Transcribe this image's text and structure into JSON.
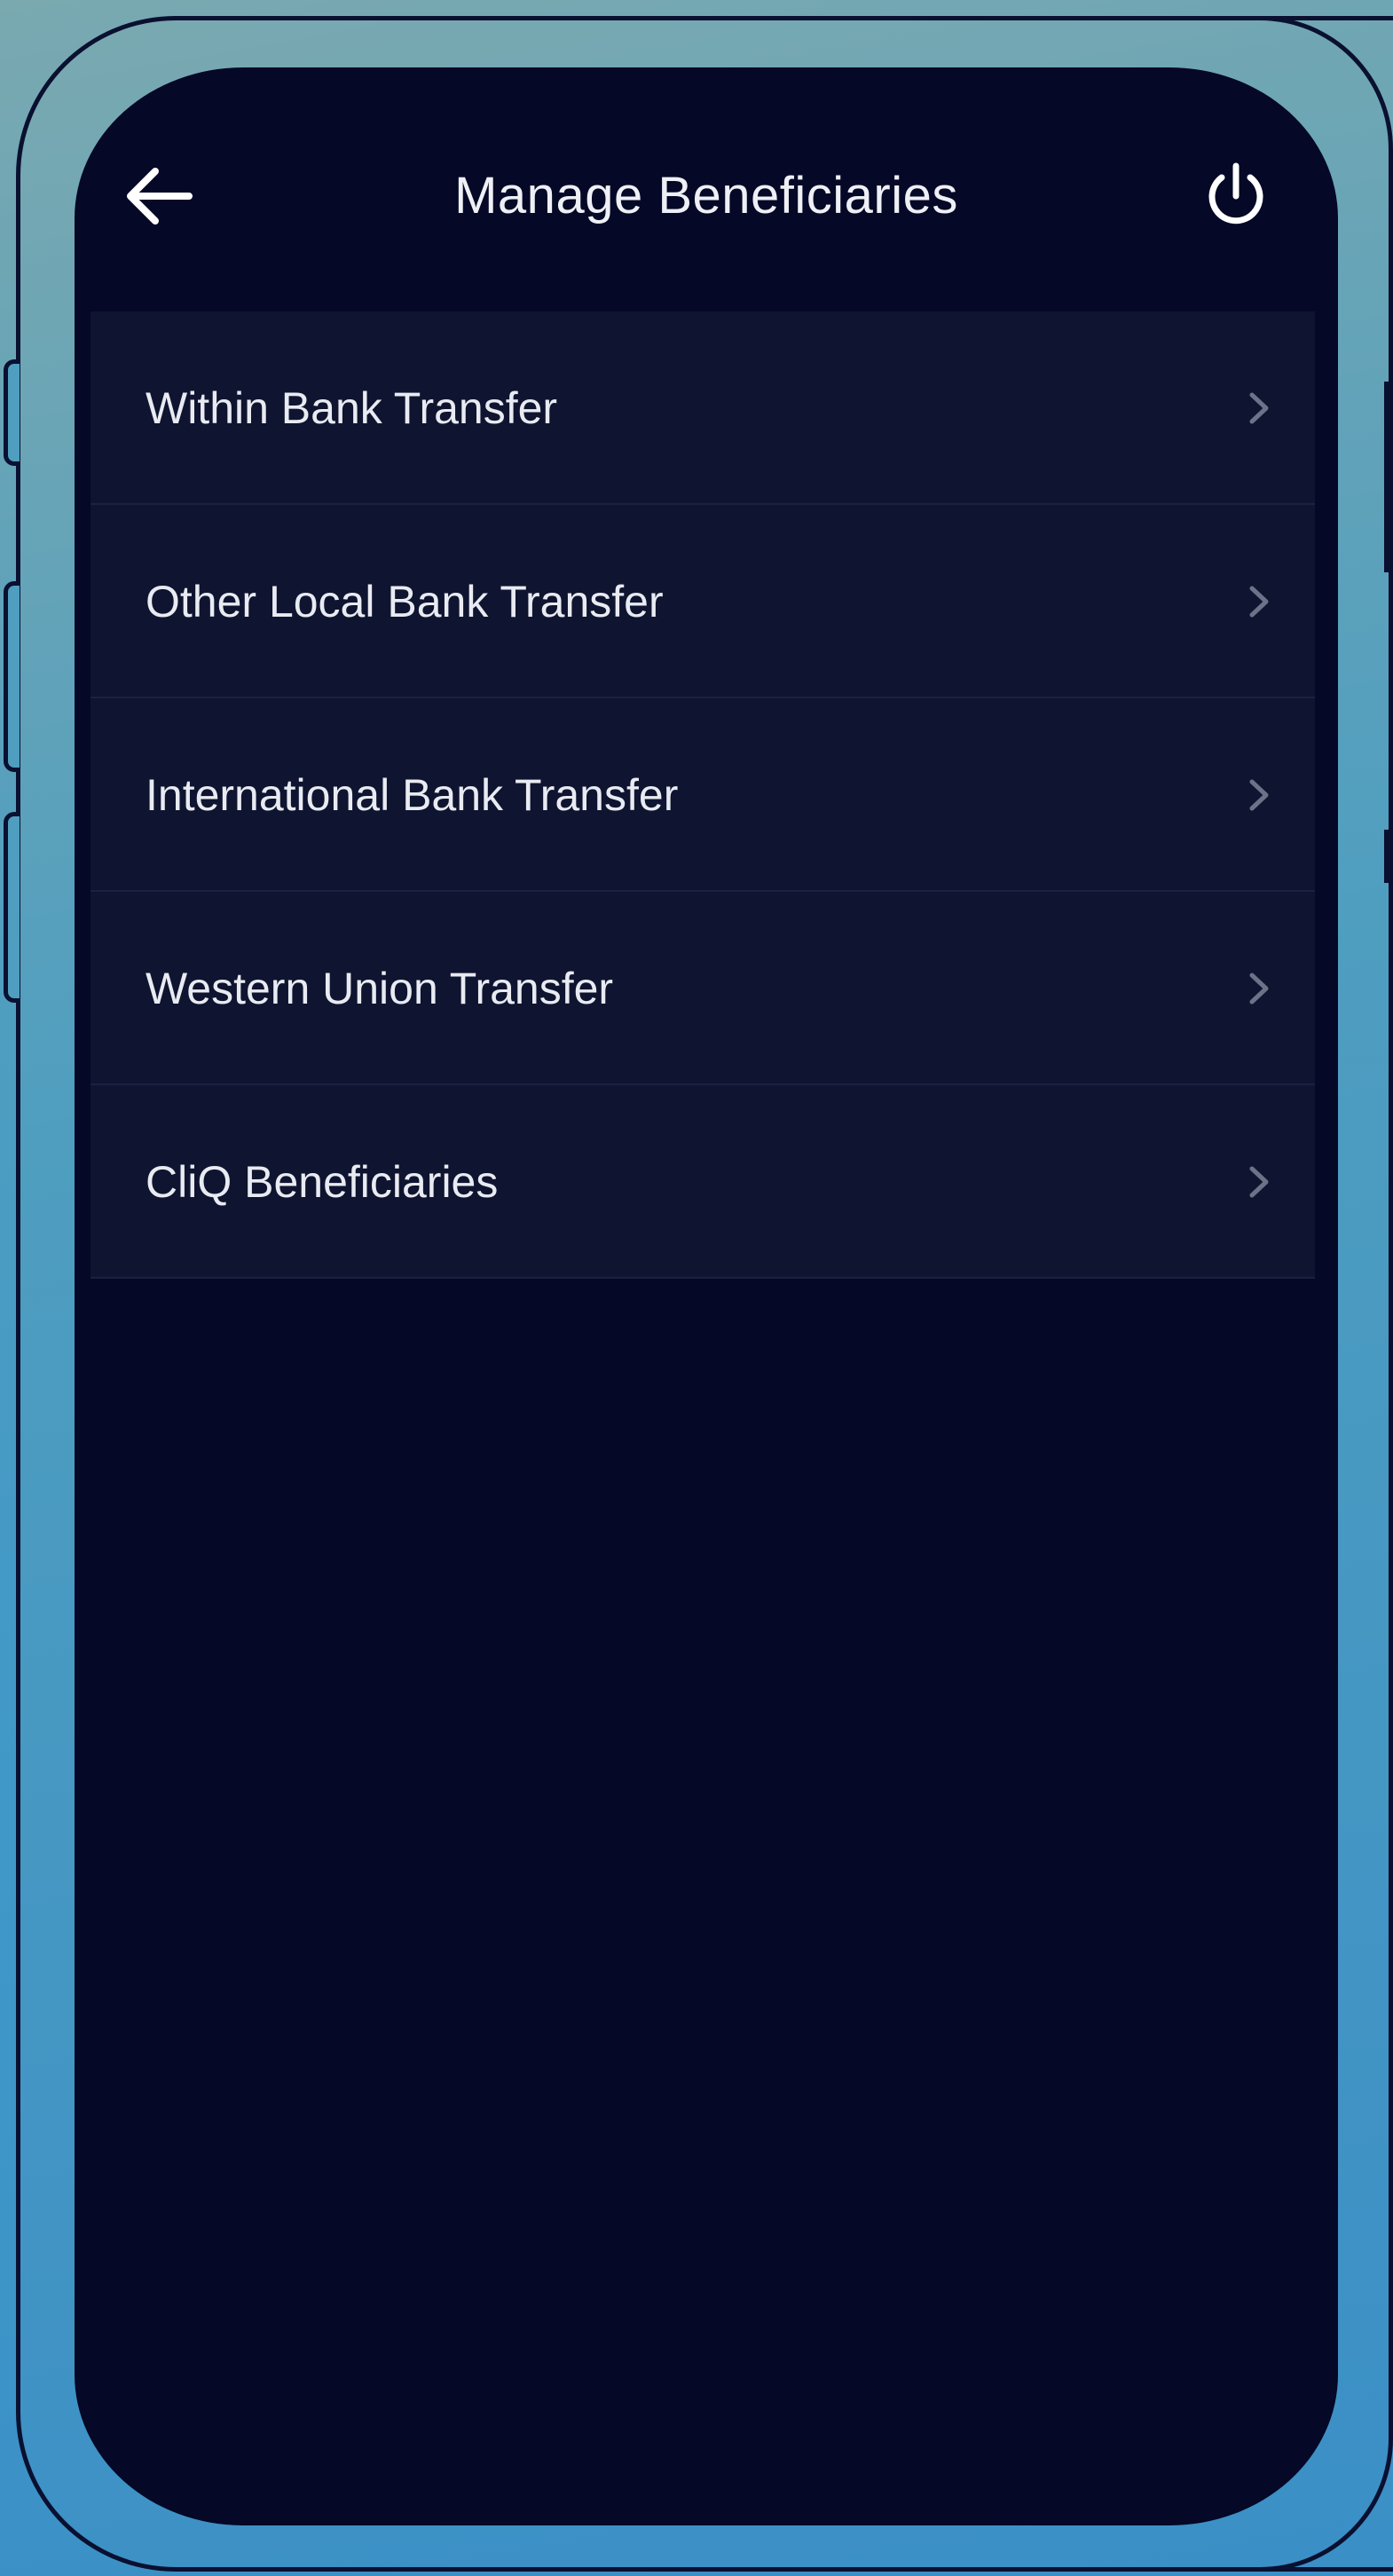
{
  "header": {
    "title": "Manage Beneficiaries",
    "back_icon": "arrow-left-icon",
    "logout_icon": "power-icon"
  },
  "beneficiary_categories": [
    {
      "label": "Within Bank Transfer"
    },
    {
      "label": "Other Local Bank Transfer"
    },
    {
      "label": "International Bank Transfer"
    },
    {
      "label": "Western Union Transfer"
    },
    {
      "label": "CliQ Beneficiaries"
    }
  ],
  "colors": {
    "screen_background": "#050826",
    "list_item_background": "#0f1430",
    "text": "#e9ebf2",
    "chevron": "#6d7288"
  }
}
